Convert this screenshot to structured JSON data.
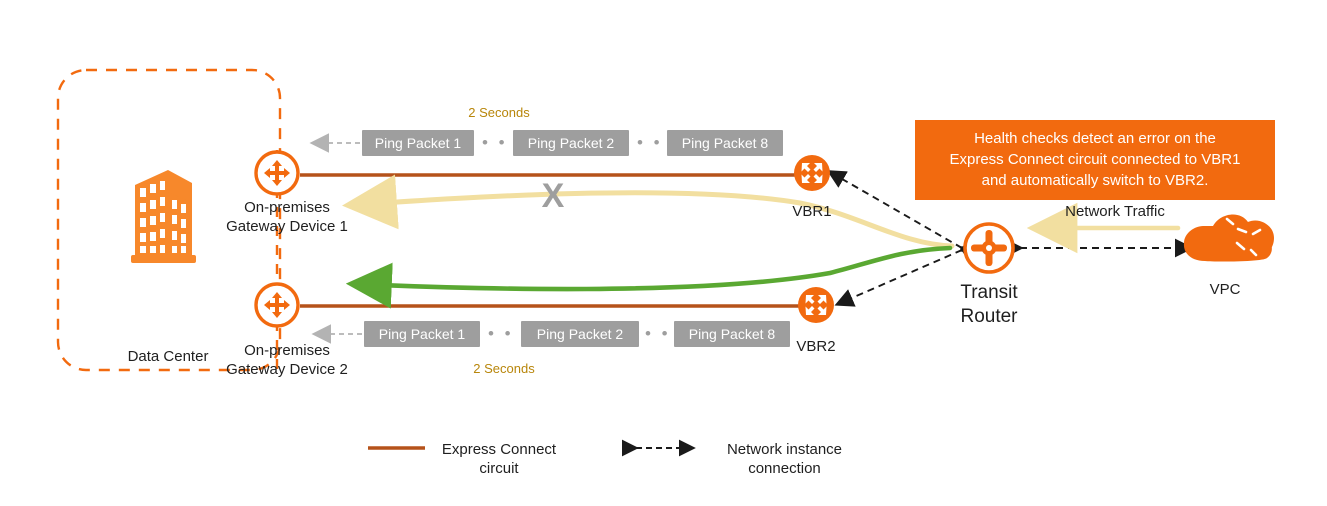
{
  "diagram": {
    "title": "Express Connect health check failover to VBR2",
    "colors": {
      "orange": "#f26a0f",
      "circuit_brown": "#b5521a",
      "packet_gray": "#9e9e9e",
      "seconds_gold": "#b8860b",
      "traffic_yellow": "#f2dfa0",
      "failover_green": "#5aa832",
      "banner_bg": "#f26a0f",
      "banner_text": "#ffffff",
      "dashed_black": "#1a1a1a"
    },
    "data_center": {
      "label": "Data Center",
      "building_icon": "office-building-icon",
      "border_style": "dashed"
    },
    "gateways": [
      {
        "icon": "router-icon",
        "label": "On-premises\nGateway Device 1"
      },
      {
        "icon": "router-icon",
        "label": "On-premises\nGateway Device 2"
      }
    ],
    "vbrs": [
      {
        "icon": "vbr-icon",
        "label": "VBR1"
      },
      {
        "icon": "vbr-icon",
        "label": "VBR2"
      }
    ],
    "transit_router": {
      "icon": "transit-router-icon",
      "label": "Transit\nRouter"
    },
    "vpc": {
      "icon": "cloud-icon",
      "label": "VPC"
    },
    "banner": {
      "line1": "Health checks detect an error on the",
      "line2": "Express Connect circuit connected to VBR1",
      "line3": "and automatically switch to VBR2."
    },
    "ping_rows": [
      {
        "interval_label": "2 Seconds",
        "interval_position": "above",
        "packets": [
          "Ping Packet 1",
          "Ping Packet 2",
          "Ping Packet 8"
        ],
        "separators": [
          "• • •",
          "• • •"
        ],
        "arrow_direction": "left"
      },
      {
        "interval_label": "2 Seconds",
        "interval_position": "below",
        "packets": [
          "Ping Packet 1",
          "Ping Packet 2",
          "Ping Packet 8"
        ],
        "separators": [
          "• • •",
          "• • •"
        ],
        "arrow_direction": "left"
      }
    ],
    "network_traffic": {
      "label": "Network Traffic",
      "arrow_direction": "left"
    },
    "failure_marker": {
      "symbol": "X",
      "meaning": "broken-path-marker"
    },
    "legend": [
      {
        "swatch": "solid-line",
        "label": "Express Connect\ncircuit"
      },
      {
        "swatch": "double-arrow-dashed",
        "label": "Network instance\nconnection"
      }
    ]
  }
}
